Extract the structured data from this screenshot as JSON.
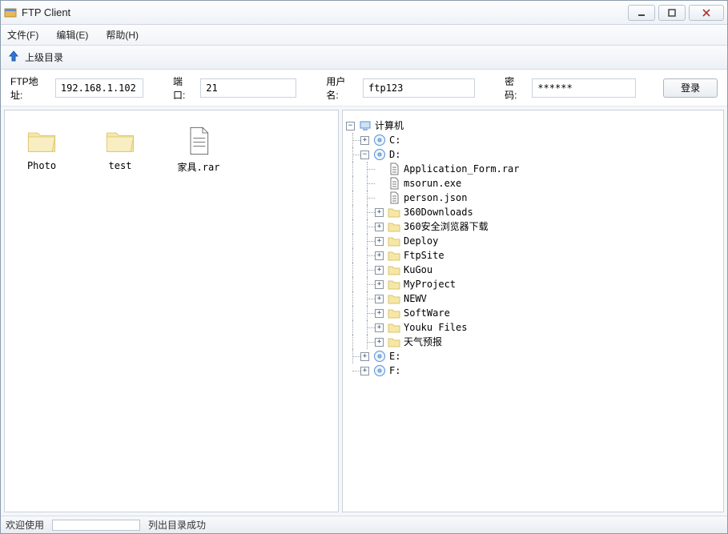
{
  "window": {
    "title": "FTP Client"
  },
  "menu": {
    "file": "文件(F)",
    "edit": "编辑(E)",
    "help": "帮助(H)"
  },
  "toolbar": {
    "up_label": "上级目录"
  },
  "conn": {
    "ip_label": "FTP地址:",
    "ip_value": "192.168.1.102",
    "port_label": "端口:",
    "port_value": "21",
    "user_label": "用户名:",
    "user_value": "ftp123",
    "pass_label": "密码:",
    "pass_value": "******",
    "login_label": "登录"
  },
  "remote": {
    "items": [
      {
        "name": "Photo",
        "type": "folder"
      },
      {
        "name": "test",
        "type": "folder"
      },
      {
        "name": "家具.rar",
        "type": "file"
      }
    ]
  },
  "tree": {
    "root": "计算机",
    "drives": {
      "c": "C:",
      "d": "D:",
      "e": "E:",
      "f": "F:"
    },
    "d_children": [
      {
        "name": "Application_Form.rar",
        "type": "file"
      },
      {
        "name": "msorun.exe",
        "type": "file"
      },
      {
        "name": "person.json",
        "type": "file"
      },
      {
        "name": "360Downloads",
        "type": "folder"
      },
      {
        "name": "360安全浏览器下载",
        "type": "folder"
      },
      {
        "name": "Deploy",
        "type": "folder"
      },
      {
        "name": "FtpSite",
        "type": "folder"
      },
      {
        "name": "KuGou",
        "type": "folder"
      },
      {
        "name": "MyProject",
        "type": "folder"
      },
      {
        "name": "NEWV",
        "type": "folder"
      },
      {
        "name": "SoftWare",
        "type": "folder"
      },
      {
        "name": "Youku Files",
        "type": "folder"
      },
      {
        "name": "天气预报",
        "type": "folder"
      }
    ]
  },
  "status": {
    "welcome": "欢迎使用",
    "message": "列出目录成功"
  }
}
